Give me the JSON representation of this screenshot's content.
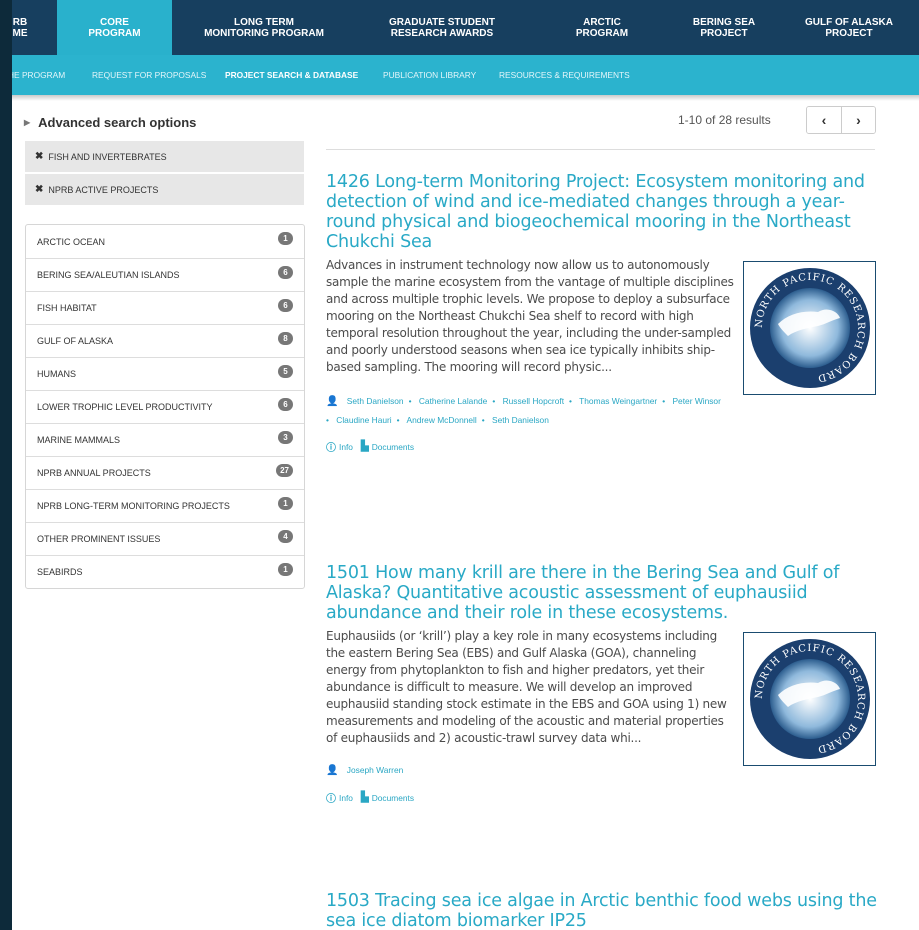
{
  "topnav": {
    "items": [
      {
        "line1": "RB",
        "line2": "ME"
      },
      {
        "line1": "CORE",
        "line2": "PROGRAM"
      },
      {
        "line1": "LONG TERM",
        "line2": "MONITORING PROGRAM"
      },
      {
        "line1": "GRADUATE STUDENT",
        "line2": "RESEARCH AWARDS"
      },
      {
        "line1": "ARCTIC",
        "line2": "PROGRAM"
      },
      {
        "line1": "BERING SEA",
        "line2": "PROJECT"
      },
      {
        "line1": "GULF OF ALASKA",
        "line2": "PROJECT"
      }
    ]
  },
  "subnav": {
    "items": [
      "HE PROGRAM",
      "REQUEST FOR PROPOSALS",
      "PROJECT SEARCH & DATABASE",
      "PUBLICATION LIBRARY",
      "RESOURCES & REQUIREMENTS"
    ]
  },
  "sidebar": {
    "advanced_label": "Advanced search options",
    "active_filters": [
      "FISH AND INVERTEBRATES",
      "NPRB ACTIVE PROJECTS"
    ],
    "facets": [
      {
        "label": "ARCTIC OCEAN",
        "count": "1"
      },
      {
        "label": "BERING SEA/ALEUTIAN ISLANDS",
        "count": "6"
      },
      {
        "label": "FISH HABITAT",
        "count": "6"
      },
      {
        "label": "GULF OF ALASKA",
        "count": "8"
      },
      {
        "label": "HUMANS",
        "count": "5"
      },
      {
        "label": "LOWER TROPHIC LEVEL PRODUCTIVITY",
        "count": "6"
      },
      {
        "label": "MARINE MAMMALS",
        "count": "3"
      },
      {
        "label": "NPRB ANNUAL PROJECTS",
        "count": "27"
      },
      {
        "label": "NPRB LONG-TERM MONITORING PROJECTS",
        "count": "1"
      },
      {
        "label": "OTHER PROMINENT ISSUES",
        "count": "4"
      },
      {
        "label": "SEABIRDS",
        "count": "1"
      }
    ]
  },
  "results": {
    "count_text": "1-10 of 28 results",
    "prev": "‹",
    "next": "›",
    "logo_text": "NORTH PACIFIC RESEARCH BOARD",
    "info_label": "Info",
    "documents_label": "Documents",
    "items": [
      {
        "title": "1426 Long-term Monitoring Project: Ecosystem monitoring and detection of wind and ice-mediated changes through a year-round physical and biogeochemical mooring in the Northeast Chukchi Sea",
        "abstract": "Advances in instrument technology now allow us to autonomously sample the marine ecosystem from the vantage of multiple disciplines and across multiple trophic levels. We propose to deploy a subsurface mooring on the Northeast Chukchi Sea shelf to record with high temporal resolution throughout the year, including the under-sampled and poorly understood seasons when sea ice typically inhibits ship-based sampling. The mooring will record physic...",
        "authors": [
          "Seth Danielson",
          "Catherine Lalande",
          "Russell Hopcroft",
          "Thomas Weingartner",
          "Peter Winsor",
          "Claudine Hauri",
          "Andrew McDonnell",
          "Seth Danielson"
        ]
      },
      {
        "title": "1501 How many krill are there in the Bering Sea and Gulf of Alaska? Quantitative acoustic assessment of euphausiid abundance and their role in these ecosystems.",
        "abstract": "Euphausiids (or ‘krill’) play a key role in many ecosystems including the eastern Bering Sea (EBS) and Gulf Alaska (GOA), channeling energy from phytoplankton to fish and higher predators, yet their abundance is difficult to measure. We will develop an improved euphausiid standing stock estimate in the EBS and GOA using 1) new measurements and modeling of the acoustic and material properties of euphausiids and 2) acoustic-trawl survey data whi...",
        "authors": [
          "Joseph Warren"
        ]
      },
      {
        "title": "1503 Tracing sea ice algae in Arctic benthic food webs using the sea ice diatom biomarker IP25"
      }
    ]
  }
}
